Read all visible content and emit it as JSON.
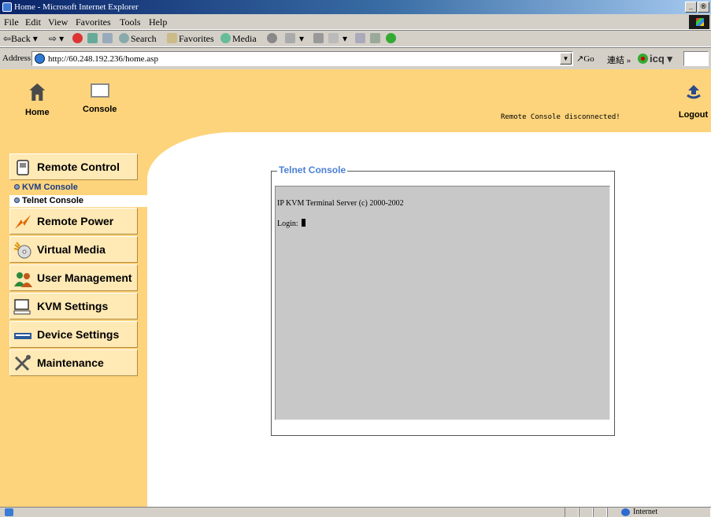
{
  "window": {
    "title": "Home - Microsoft Internet Explorer",
    "controls": [
      "_",
      "®",
      "x"
    ]
  },
  "menubar": {
    "items": [
      "File",
      "Edit",
      "View",
      "Favorites",
      "Tools",
      "Help"
    ]
  },
  "toolbar": {
    "back": "⇦Back",
    "forward": "⇨",
    "search": "Search",
    "favorites": "Favorites",
    "media": "Media"
  },
  "address_bar": {
    "label": "Address",
    "url": "http://60.248.192.236/home.asp",
    "go": "Go",
    "links": "連結 »",
    "icq": "icq"
  },
  "header": {
    "home": "Home",
    "console": "Console",
    "status_message": "Remote Console disconnected!",
    "logout": "Logout"
  },
  "sidebar": {
    "remote_control": "Remote Control",
    "sub_items": [
      "KVM Console",
      "Telnet Console"
    ],
    "items": [
      "Remote Power",
      "Virtual Media",
      "User Management",
      "KVM Settings",
      "Device Settings",
      "Maintenance"
    ]
  },
  "telnet": {
    "legend": "Telnet Console",
    "line1": "IP KVM Terminal Server (c) 2000-2002",
    "line2": "Login:"
  },
  "statusbar": {
    "zone": "Internet"
  },
  "colors": {
    "panel_yellow": "#fdd47b",
    "menu_box": "#ffe9b5",
    "legend_blue": "#4a7fd4",
    "terminal_gray": "#c8c8c8"
  }
}
